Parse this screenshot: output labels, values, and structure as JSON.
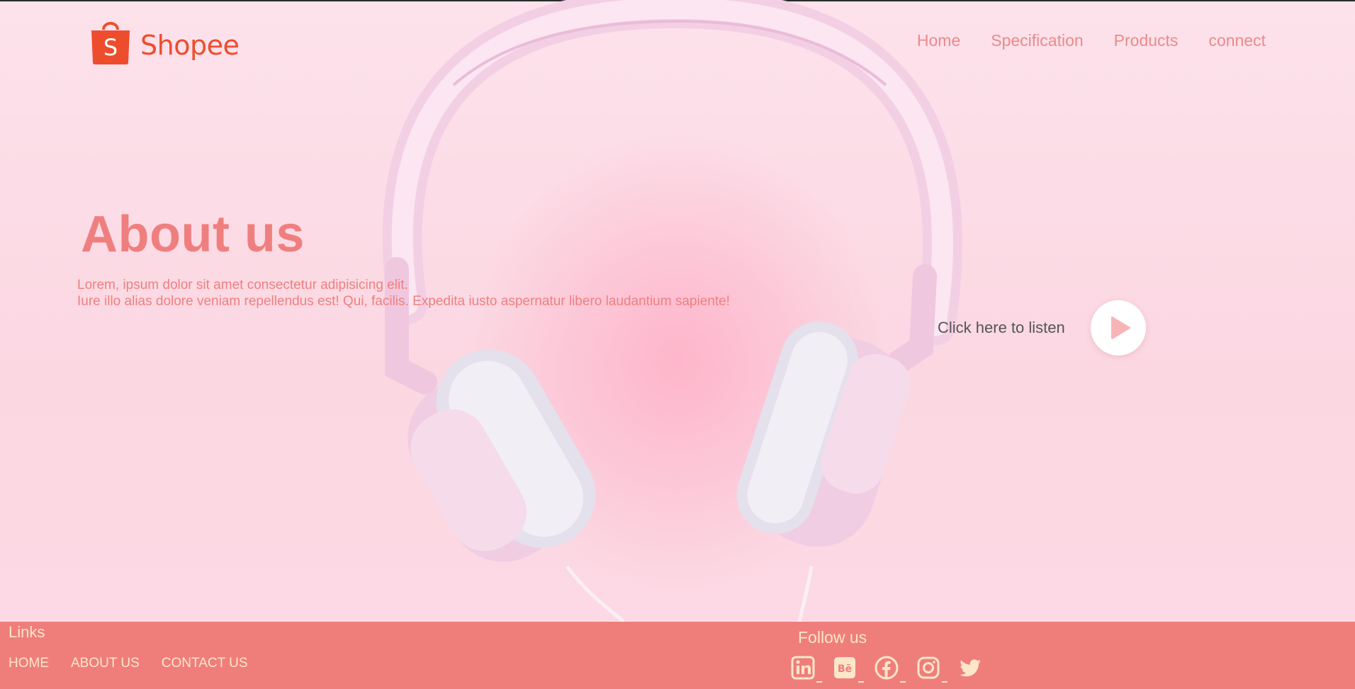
{
  "brand": {
    "name": "Shopee",
    "logo_letter": "S",
    "logo_color": "#ee4d2d"
  },
  "nav": [
    {
      "label": "Home"
    },
    {
      "label": "Specification"
    },
    {
      "label": "Products"
    },
    {
      "label": "connect"
    }
  ],
  "hero": {
    "title": "About us",
    "text_line1": "Lorem, ipsum dolor sit amet consectetur adipisicing elit.",
    "text_line2": "Iure illo alias dolore veniam repellendus est! Qui, facilis. Expedita iusto aspernatur libero laudantium sapiente!",
    "listen_label": "Click here to listen",
    "play_icon": "play-icon"
  },
  "footer": {
    "links_title": "Links",
    "links": [
      {
        "label": "HOME"
      },
      {
        "label": "ABOUT US"
      },
      {
        "label": "CONTACT US"
      }
    ],
    "follow_title": "Follow us",
    "socials": [
      "linkedin-icon",
      "behance-icon",
      "facebook-icon",
      "instagram-icon",
      "twitter-icon"
    ]
  },
  "colors": {
    "accent": "#ef7f7f",
    "footer_bg": "#ef7e7b",
    "footer_text": "#fde6c9",
    "hero_bg": "#fbd9e3"
  }
}
